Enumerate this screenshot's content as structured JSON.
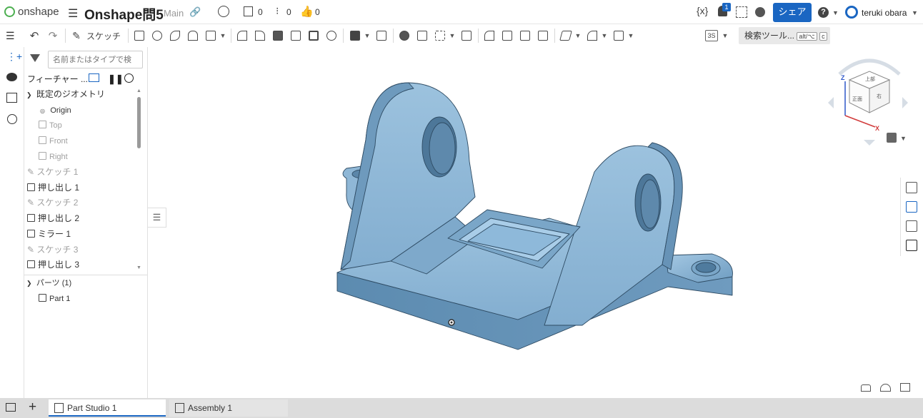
{
  "header": {
    "logo_text": "onshape",
    "document_title": "Onshape問5",
    "branch": "Main",
    "versions_count": "0",
    "branches_count": "0",
    "likes_count": "0",
    "notification_count": "1",
    "share_label": "シェア",
    "user_name": "teruki obara"
  },
  "toolbar": {
    "sketch_label": "スケッチ",
    "units_label": "3S",
    "search_tools_label": "検索ツール...",
    "shortcut_key1": "alt/⌥",
    "shortcut_key2": "c"
  },
  "feature_panel": {
    "search_placeholder": "名前またはタイプで検",
    "header_label": "フィーチャー ...",
    "default_geometry_label": "既定のジオメトリ",
    "geometry_items": [
      "Origin",
      "Top",
      "Front",
      "Right"
    ],
    "features": [
      {
        "label": "スケッチ 1",
        "type": "sketch"
      },
      {
        "label": "押し出し 1",
        "type": "extrude"
      },
      {
        "label": "スケッチ 2",
        "type": "sketch"
      },
      {
        "label": "押し出し 2",
        "type": "extrude"
      },
      {
        "label": "ミラー 1",
        "type": "mirror"
      },
      {
        "label": "スケッチ 3",
        "type": "sketch"
      },
      {
        "label": "押し出し 3",
        "type": "extrude"
      }
    ],
    "parts_label": "パーツ (1)",
    "parts": [
      "Part 1"
    ]
  },
  "view_cube": {
    "face_top": "上部",
    "face_front": "正面",
    "face_right": "右",
    "axis_z": "Z",
    "axis_x": "X"
  },
  "bottom_tabs": [
    {
      "label": "Part Studio 1",
      "active": true
    },
    {
      "label": "Assembly 1",
      "active": false
    }
  ],
  "colors": {
    "accent": "#1a66c2",
    "part_fill": "#8fb8d8",
    "part_shadow": "#5a88ad",
    "part_edge": "#2e4b63"
  }
}
